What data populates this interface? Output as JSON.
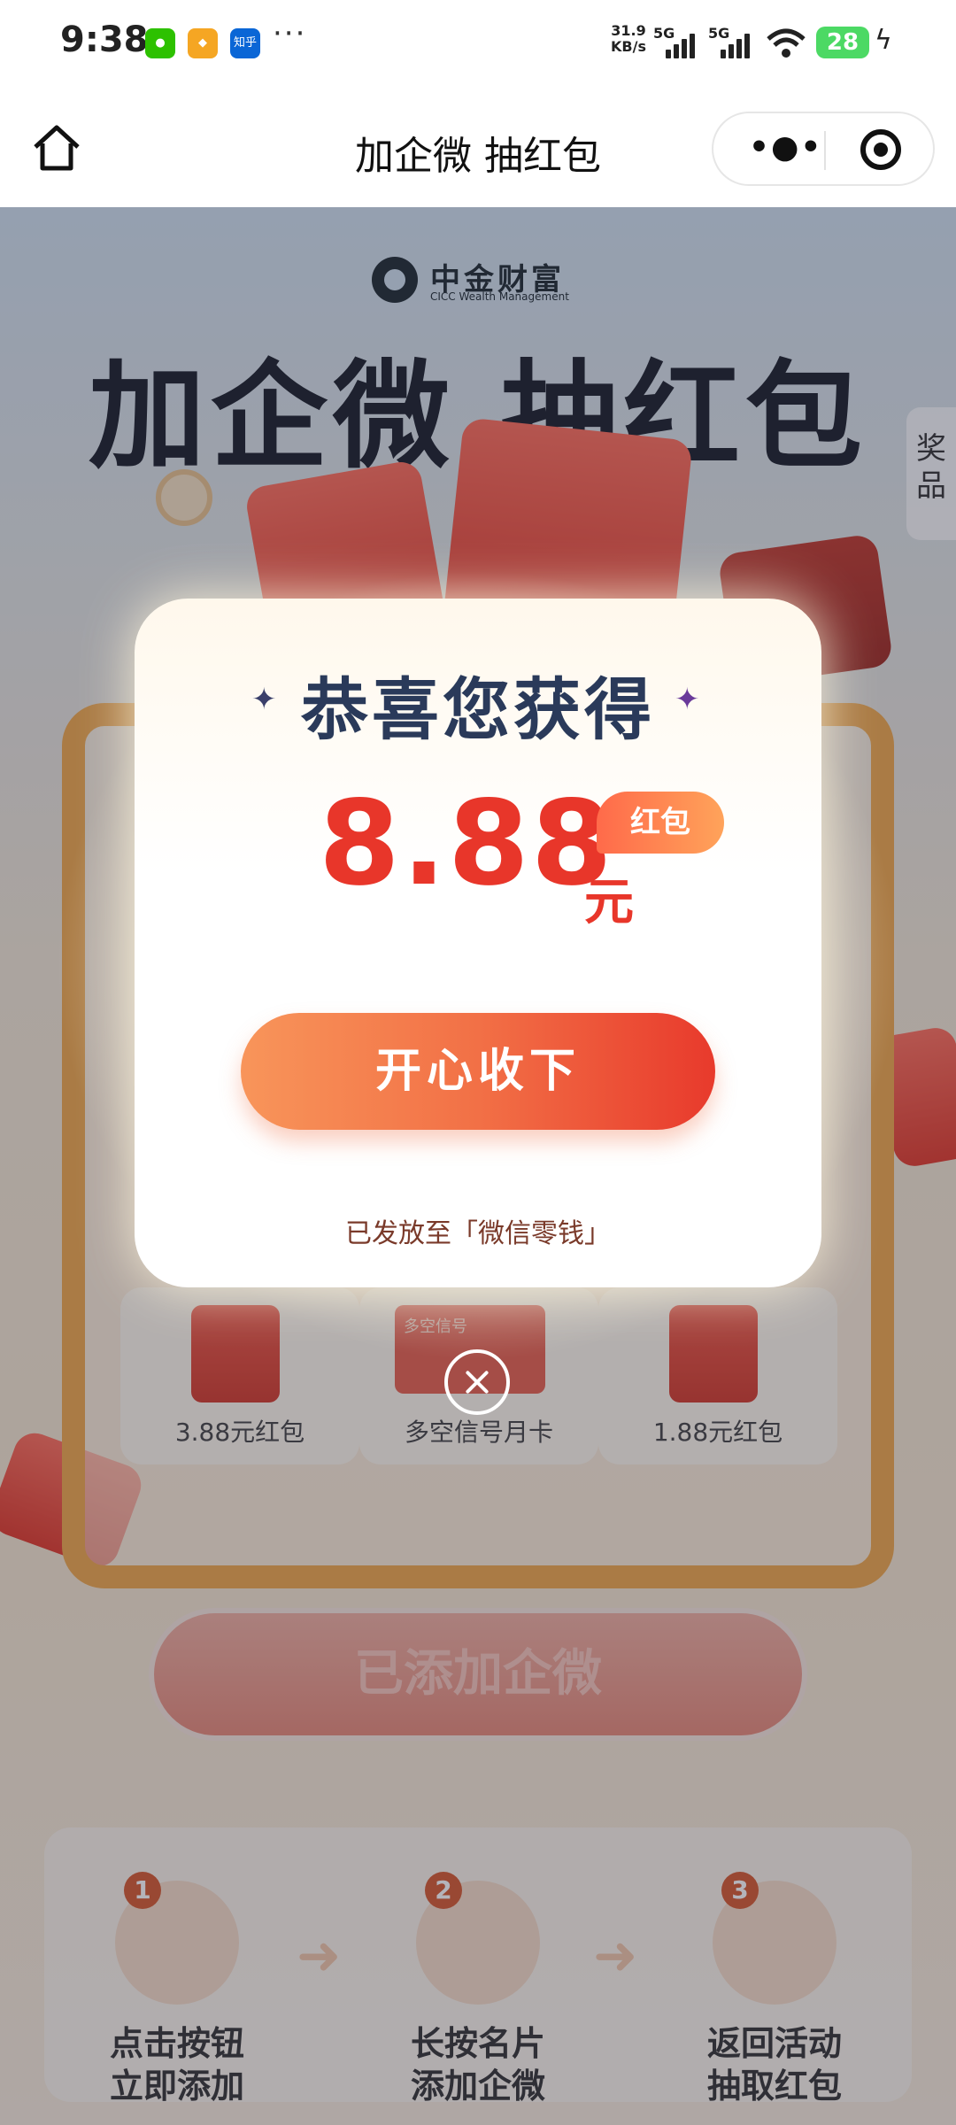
{
  "status_bar": {
    "time": "9:38",
    "app_icons": [
      "wechat-icon",
      "shield-app-icon",
      "zhihu-icon"
    ],
    "zhihu_label": "知乎",
    "more": "···",
    "net_speed_value": "31.9",
    "net_speed_unit": "KB/s",
    "signal_1": "5G",
    "signal_2": "5G",
    "battery": "28"
  },
  "nav": {
    "title": "加企微 抽红包",
    "home_icon": "home-icon",
    "more_icon": "more-dots-icon",
    "close_icon": "target-icon"
  },
  "page": {
    "brand_name": "中金财富",
    "brand_en": "CICC Wealth Management",
    "hero_title": "加企微 抽红包",
    "prize_tab": "奖品",
    "grid_items": [
      {
        "label": "3.88元红包"
      },
      {
        "label": "多空信号月卡",
        "card_text": "多空信号"
      },
      {
        "label": "1.88元红包"
      }
    ],
    "added_button": "已添加企微",
    "steps": [
      {
        "num": "1",
        "line1": "点击按钮",
        "line2": "立即添加"
      },
      {
        "num": "2",
        "line1": "长按名片",
        "line2": "添加企微"
      },
      {
        "num": "3",
        "line1": "返回活动",
        "line2": "抽取红包"
      }
    ]
  },
  "modal": {
    "title": "恭喜您获得",
    "badge": "红包",
    "amount": "8.88",
    "unit": "元",
    "accept_button": "开心收下",
    "note": "已发放至「微信零钱」"
  },
  "colors": {
    "accent_red": "#e8362a",
    "button_orange": "#f27046",
    "title_navy": "#2a3a5a"
  }
}
